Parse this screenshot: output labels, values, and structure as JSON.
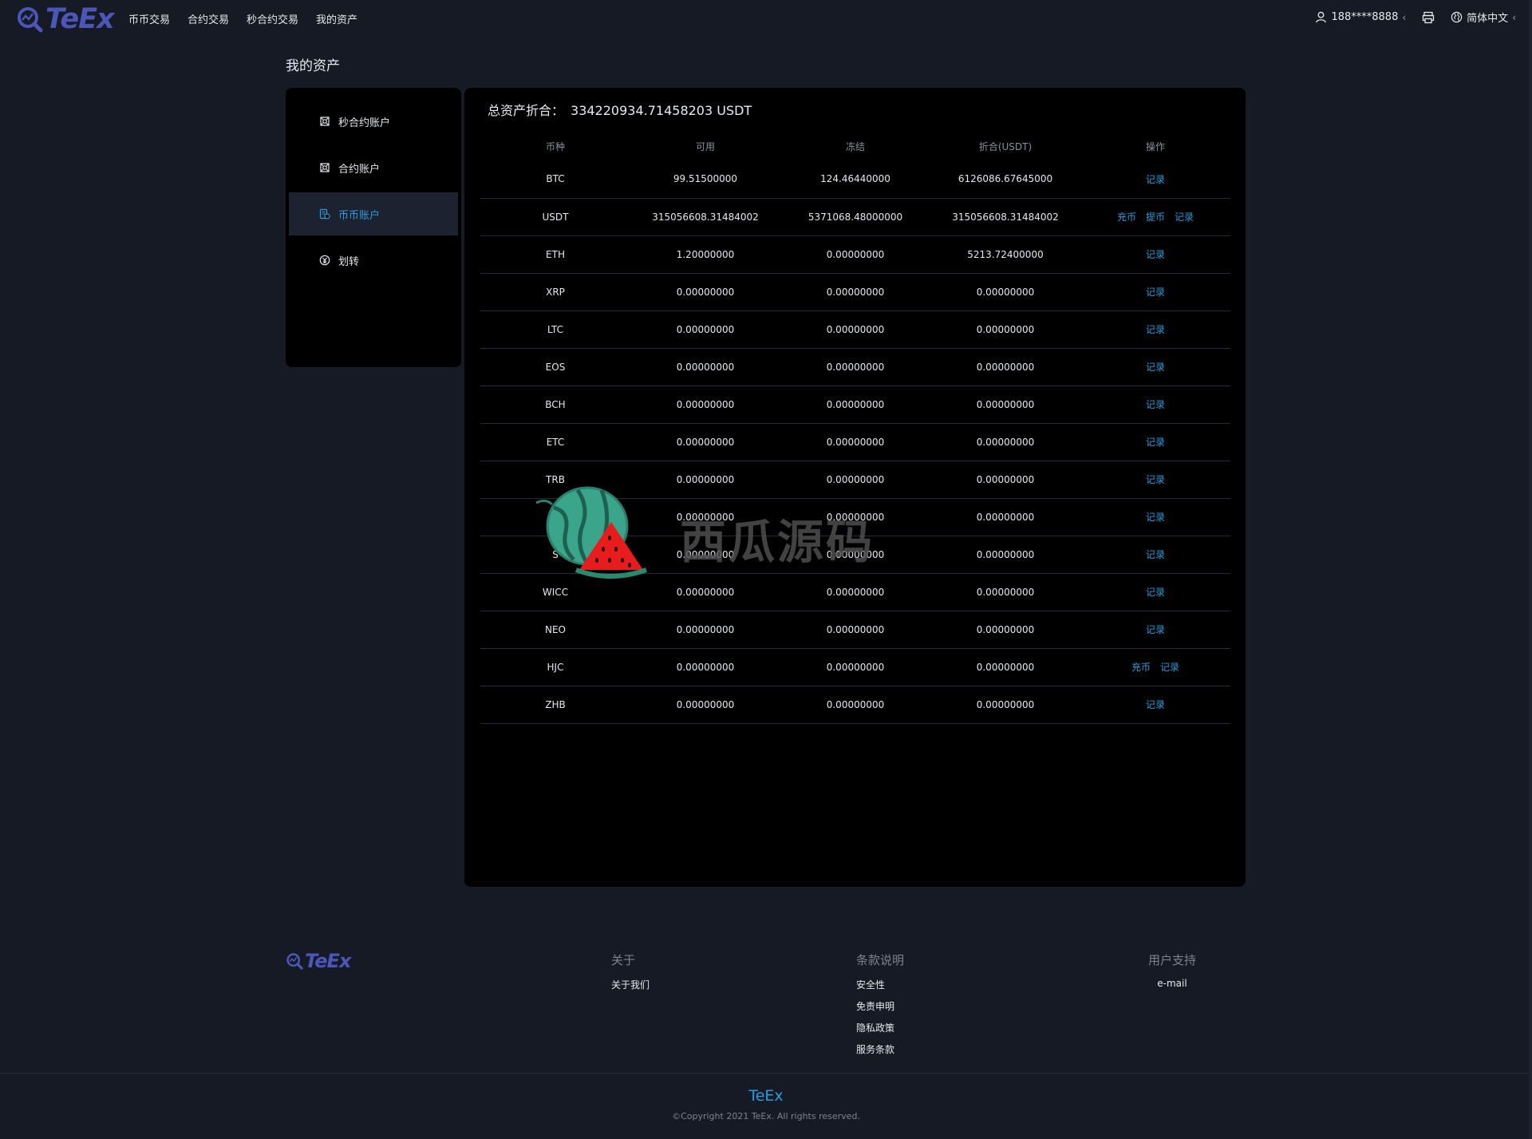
{
  "header": {
    "logo_text": "TeEx",
    "nav": [
      "币币交易",
      "合约交易",
      "秒合约交易",
      "我的资产"
    ],
    "user": "188****8888",
    "language": "简体中文"
  },
  "page_title": "我的资产",
  "sidebar": {
    "items": [
      {
        "label": "秒合约账户",
        "icon": "contract-icon",
        "active": false
      },
      {
        "label": "合约账户",
        "icon": "contract-icon",
        "active": false
      },
      {
        "label": "币币账户",
        "icon": "wallet-icon",
        "active": true
      },
      {
        "label": "划转",
        "icon": "transfer-icon",
        "active": false
      }
    ]
  },
  "summary": {
    "label": "总资产折合：",
    "amount": "334220934.71458203 USDT"
  },
  "table": {
    "columns": [
      "币种",
      "可用",
      "冻结",
      "折合(USDT)",
      "操作"
    ],
    "rows": [
      {
        "coin": "BTC",
        "available": "99.51500000",
        "frozen": "124.46440000",
        "value": "6126086.67645000",
        "ops": [
          "记录"
        ]
      },
      {
        "coin": "USDT",
        "available": "315056608.31484002",
        "frozen": "5371068.48000000",
        "value": "315056608.31484002",
        "ops": [
          "充币",
          "提币",
          "记录"
        ]
      },
      {
        "coin": "ETH",
        "available": "1.20000000",
        "frozen": "0.00000000",
        "value": "5213.72400000",
        "ops": [
          "记录"
        ]
      },
      {
        "coin": "XRP",
        "available": "0.00000000",
        "frozen": "0.00000000",
        "value": "0.00000000",
        "ops": [
          "记录"
        ]
      },
      {
        "coin": "LTC",
        "available": "0.00000000",
        "frozen": "0.00000000",
        "value": "0.00000000",
        "ops": [
          "记录"
        ]
      },
      {
        "coin": "EOS",
        "available": "0.00000000",
        "frozen": "0.00000000",
        "value": "0.00000000",
        "ops": [
          "记录"
        ]
      },
      {
        "coin": "BCH",
        "available": "0.00000000",
        "frozen": "0.00000000",
        "value": "0.00000000",
        "ops": [
          "记录"
        ]
      },
      {
        "coin": "ETC",
        "available": "0.00000000",
        "frozen": "0.00000000",
        "value": "0.00000000",
        "ops": [
          "记录"
        ]
      },
      {
        "coin": "TRB",
        "available": "0.00000000",
        "frozen": "0.00000000",
        "value": "0.00000000",
        "ops": [
          "记录"
        ]
      },
      {
        "coin": "I",
        "available": "0.00000000",
        "frozen": "0.00000000",
        "value": "0.00000000",
        "ops": [
          "记录"
        ]
      },
      {
        "coin": "S",
        "available": "0.00000000",
        "frozen": "0.00000000",
        "value": "0.00000000",
        "ops": [
          "记录"
        ]
      },
      {
        "coin": "WICC",
        "available": "0.00000000",
        "frozen": "0.00000000",
        "value": "0.00000000",
        "ops": [
          "记录"
        ]
      },
      {
        "coin": "NEO",
        "available": "0.00000000",
        "frozen": "0.00000000",
        "value": "0.00000000",
        "ops": [
          "记录"
        ]
      },
      {
        "coin": "HJC",
        "available": "0.00000000",
        "frozen": "0.00000000",
        "value": "0.00000000",
        "ops": [
          "充币",
          "记录"
        ]
      },
      {
        "coin": "ZHB",
        "available": "0.00000000",
        "frozen": "0.00000000",
        "value": "0.00000000",
        "ops": [
          "记录"
        ]
      }
    ]
  },
  "watermark": {
    "text": "西瓜源码"
  },
  "footer": {
    "logo_text": "TeEx",
    "columns": [
      {
        "title": "关于",
        "links": [
          "关于我们"
        ]
      },
      {
        "title": "条款说明",
        "links": [
          "安全性",
          "免责申明",
          "隐私政策",
          "服务条款"
        ]
      },
      {
        "title": "用户支持",
        "links": [
          "e-mail"
        ]
      }
    ],
    "brand": "TeEx",
    "copyright": "©Copyright 2021 TeEx. All rights reserved."
  },
  "colors": {
    "background": "#161a24",
    "panel": "#000000",
    "accent": "#2d9cdb",
    "logo": "#4b56b8"
  }
}
